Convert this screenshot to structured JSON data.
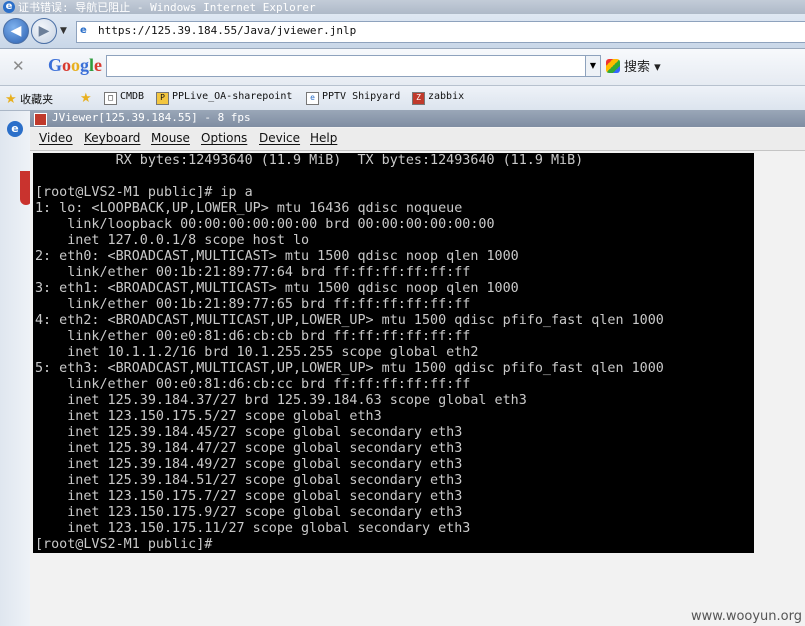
{
  "browser": {
    "window_title": "证书错误: 导航已阻止 - Windows Internet Explorer",
    "address_url": "https://125.39.184.55/Java/jviewer.jnlp",
    "google_logo": "Google",
    "google_search_value": "",
    "google_search_button": "搜索",
    "favorites_label": "收藏夹",
    "favorites": [
      "CMDB",
      "PPLive_OA-sharepoint",
      "PPTV Shipyard",
      "zabbix"
    ]
  },
  "jviewer": {
    "title": "JViewer[125.39.184.55] - 8 fps",
    "menus": [
      "Video",
      "Keyboard",
      "Mouse",
      "Options",
      "Device",
      "Help"
    ]
  },
  "terminal": {
    "lines": [
      "          RX bytes:12493640 (11.9 MiB)  TX bytes:12493640 (11.9 MiB)",
      "",
      "[root@LVS2-M1 public]# ip a",
      "1: lo: <LOOPBACK,UP,LOWER_UP> mtu 16436 qdisc noqueue",
      "    link/loopback 00:00:00:00:00:00 brd 00:00:00:00:00:00",
      "    inet 127.0.0.1/8 scope host lo",
      "2: eth0: <BROADCAST,MULTICAST> mtu 1500 qdisc noop qlen 1000",
      "    link/ether 00:1b:21:89:77:64 brd ff:ff:ff:ff:ff:ff",
      "3: eth1: <BROADCAST,MULTICAST> mtu 1500 qdisc noop qlen 1000",
      "    link/ether 00:1b:21:89:77:65 brd ff:ff:ff:ff:ff:ff",
      "4: eth2: <BROADCAST,MULTICAST,UP,LOWER_UP> mtu 1500 qdisc pfifo_fast qlen 1000",
      "    link/ether 00:e0:81:d6:cb:cb brd ff:ff:ff:ff:ff:ff",
      "    inet 10.1.1.2/16 brd 10.1.255.255 scope global eth2",
      "5: eth3: <BROADCAST,MULTICAST,UP,LOWER_UP> mtu 1500 qdisc pfifo_fast qlen 1000",
      "    link/ether 00:e0:81:d6:cb:cc brd ff:ff:ff:ff:ff:ff",
      "    inet 125.39.184.37/27 brd 125.39.184.63 scope global eth3",
      "    inet 123.150.175.5/27 scope global eth3",
      "    inet 125.39.184.45/27 scope global secondary eth3",
      "    inet 125.39.184.47/27 scope global secondary eth3",
      "    inet 125.39.184.49/27 scope global secondary eth3",
      "    inet 125.39.184.51/27 scope global secondary eth3",
      "    inet 123.150.175.7/27 scope global secondary eth3",
      "    inet 123.150.175.9/27 scope global secondary eth3",
      "    inet 123.150.175.11/27 scope global secondary eth3",
      "[root@LVS2-M1 public]#"
    ]
  },
  "watermark": "www.wooyun.org"
}
